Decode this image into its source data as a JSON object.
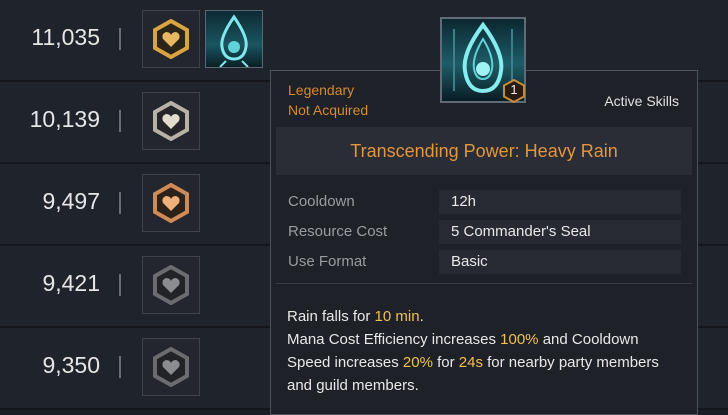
{
  "rows": [
    {
      "value": "11,035",
      "tier": "gold"
    },
    {
      "value": "10,139",
      "tier": "silver"
    },
    {
      "value": "9,497",
      "tier": "bronze"
    },
    {
      "value": "9,421",
      "tier": "dark"
    },
    {
      "value": "9,350",
      "tier": "dark"
    }
  ],
  "tooltip": {
    "rarity": "Legendary",
    "status": "Not Acquired",
    "category": "Active Skills",
    "stack_count": "1",
    "title": "Transcending Power: Heavy Rain",
    "stats": [
      {
        "label": "Cooldown",
        "value": "12h"
      },
      {
        "label": "Resource Cost",
        "value": "5  Commander's Seal"
      },
      {
        "label": "Use Format",
        "value": "Basic"
      }
    ],
    "description": {
      "l1a": "Rain falls for ",
      "l1b": "10 min",
      "l1c": ".",
      "l2a": "Mana Cost Efficiency increases ",
      "l2b": "100%",
      "l2c": " and Cooldown",
      "l3a": "Speed increases ",
      "l3b": "20%",
      "l3c": " for ",
      "l3d": "24s",
      "l3e": " for nearby party members",
      "l4": "and guild members."
    }
  },
  "colors": {
    "rarity": "#d98a2c",
    "highlight": "#f0c050",
    "gold": "#d9a441",
    "silver": "#b8b2a6",
    "bronze": "#d08a55",
    "dark": "#6a6c70"
  },
  "icons": {
    "badge": "heart-hexagon-icon",
    "skill": "water-drop-icon"
  }
}
